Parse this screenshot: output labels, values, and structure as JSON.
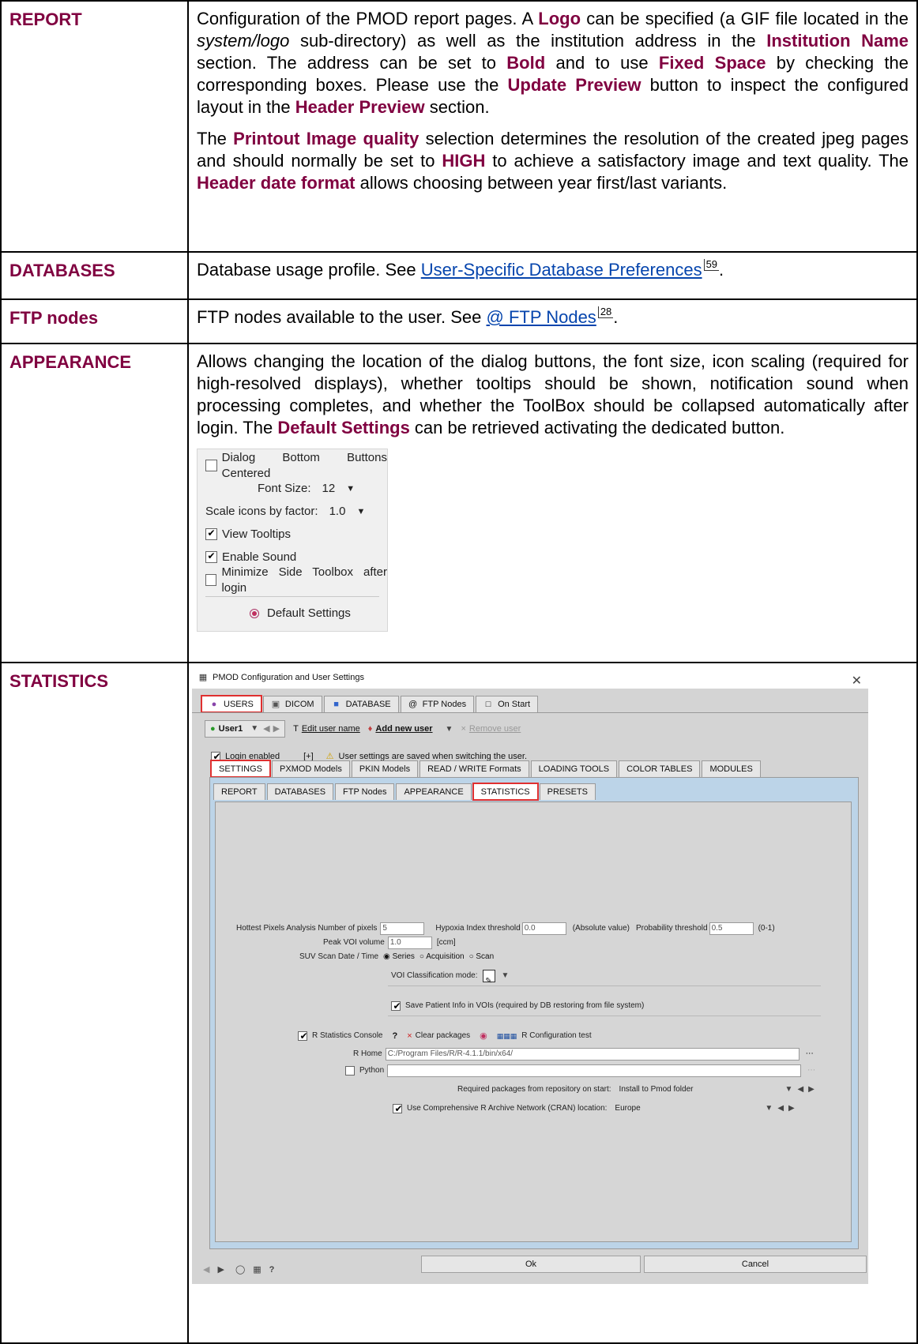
{
  "rows": {
    "report": {
      "key": "REPORT",
      "p1": [
        "Configuration of the PMOD report pages. A ",
        "Logo",
        " can be specified (a GIF file located in the ",
        "system/logo",
        " sub-directory) as well as the institution address in the ",
        "Institution Name",
        " section. The address can be set to ",
        "Bold",
        " and to use ",
        "Fixed Space",
        " by checking the corresponding boxes. Please use the ",
        "Update Preview",
        " button to inspect the configured layout in the ",
        "Header Preview",
        " section."
      ],
      "p2": [
        "The ",
        "Printout Image quality",
        " selection determines the resolution of the created jpeg pages and should normally be set to ",
        "HIGH",
        " to achieve a satisfactory image and text quality. The ",
        "Header date format",
        " allows choosing between year first/last variants."
      ]
    },
    "databases": {
      "key": "DATABASES",
      "text": "Database usage profile. See ",
      "link": "User-Specific Database Preferences",
      "page": "59",
      "end": "."
    },
    "ftp": {
      "key": "FTP nodes",
      "text": "FTP nodes available to the user. See ",
      "link": "@ FTP Nodes",
      "page": "28",
      "end": "."
    },
    "appearance": {
      "key": "APPEARANCE",
      "text": [
        "Allows changing the location of the dialog buttons, the font size, icon scaling (required for high-resolved displays), whether tooltips should be shown, notification sound when processing completes, and whether the ToolBox should be collapsed automatically after login. The ",
        "Default Settings",
        " can be retrieved activating the dedicated button."
      ],
      "panel": {
        "centered": {
          "label": "Dialog Bottom Buttons Centered",
          "checked": false
        },
        "font_label": "Font Size:",
        "font_value": "12",
        "scale_label": "Scale icons by factor:",
        "scale_value": "1.0",
        "tooltips": {
          "label": "View Tooltips",
          "checked": true
        },
        "sound": {
          "label": "Enable Sound",
          "checked": true
        },
        "minimize": {
          "label": "Minimize Side Toolbox after login",
          "checked": false
        },
        "default_btn": "Default Settings"
      }
    },
    "statistics": {
      "key": "STATISTICS"
    }
  },
  "dialog": {
    "title": "PMOD Configuration and User Settings",
    "top_tabs": [
      "USERS",
      "DICOM",
      "DATABASE",
      "FTP Nodes",
      "On Start"
    ],
    "user": "User1",
    "edit_user": "Edit user name",
    "add_user": "Add new user",
    "remove_user": "Remove user",
    "login_enabled": "Login enabled",
    "plus": "[+]",
    "saved_note": "User settings are saved when switching the user.",
    "settings_tabs": [
      "SETTINGS",
      "PXMOD Models",
      "PKIN Models",
      "READ / WRITE Formats",
      "LOADING TOOLS",
      "COLOR TABLES",
      "MODULES"
    ],
    "sub_tabs": [
      "REPORT",
      "DATABASES",
      "FTP Nodes",
      "APPEARANCE",
      "STATISTICS",
      "PRESETS"
    ],
    "hottest_label": "Hottest Pixels Analysis Number of pixels",
    "hottest_value": "5",
    "hypoxia_label": "Hypoxia Index threshold",
    "hypoxia_value": "0.0",
    "absolute": "(Absolute value)",
    "prob_label": "Probability threshold",
    "prob_value": "0.5",
    "prob_range": "(0-1)",
    "peak_label": "Peak VOI volume",
    "peak_value": "1.0",
    "peak_unit": "[ccm]",
    "suv_label": "SUV Scan Date / Time",
    "suv_opts": [
      "Series",
      "Acquisition",
      "Scan"
    ],
    "voi_class": "VOI Classification mode:",
    "save_patient": "Save Patient Info in VOIs (required by DB restoring from file system)",
    "r_console": "R Statistics Console",
    "q": "?",
    "clear_pkgs": "Clear packages",
    "r_config": "R Configuration test",
    "r_home_label": "R Home",
    "r_home_value": "C:/Program Files/R/R-4.1.1/bin/x64/",
    "python_label": "Python",
    "req_pkgs_label": "Required packages from repository on start:",
    "req_pkgs_value": "Install to Pmod folder",
    "cran_label": "Use Comprehensive R Archive Network (CRAN) location:",
    "cran_value": "Europe",
    "ok": "Ok",
    "cancel": "Cancel"
  }
}
